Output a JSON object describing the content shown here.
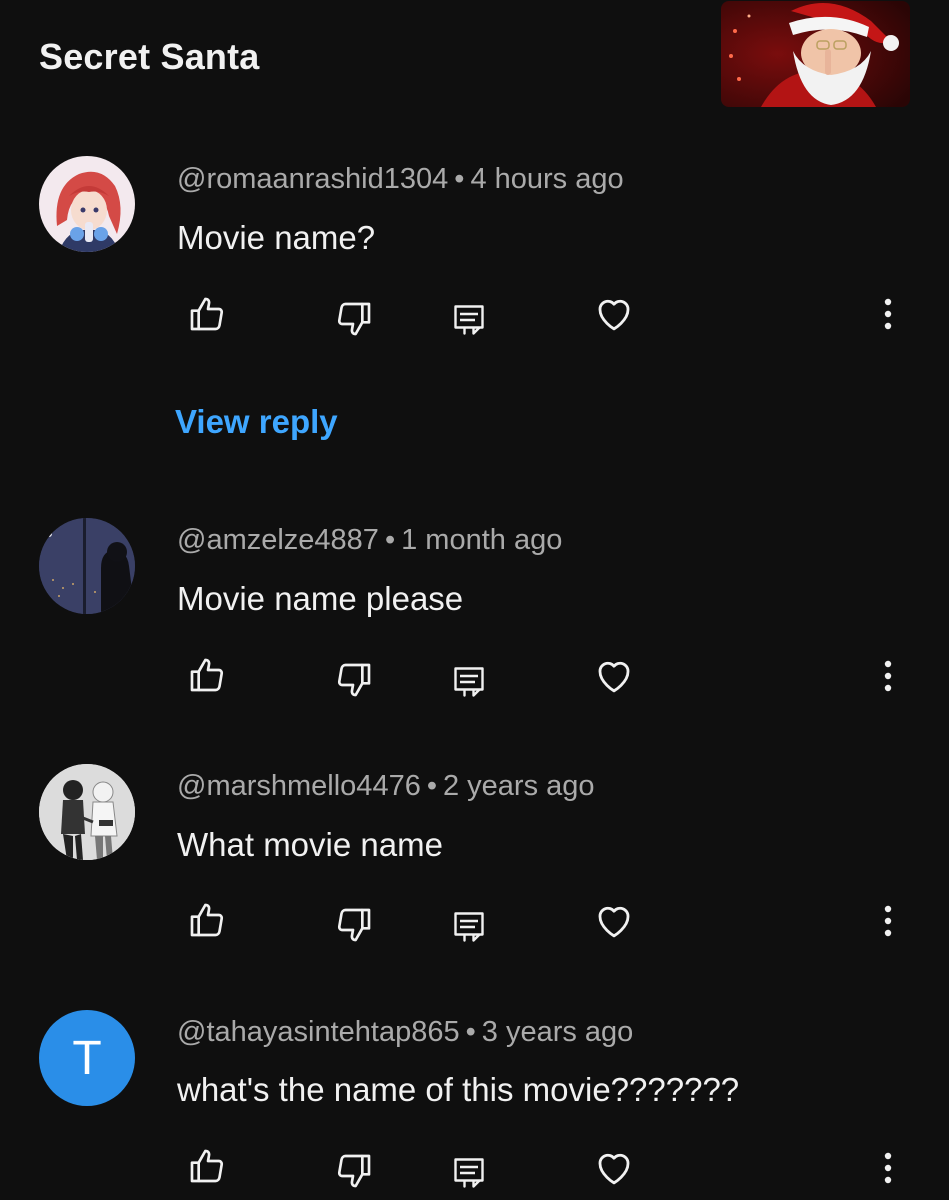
{
  "header": {
    "title": "Secret Santa"
  },
  "comments": [
    {
      "author": "@romaanrashid1304",
      "time": "4 hours ago",
      "text": "Movie name?",
      "avatar": "anime-girl-avatar",
      "view_reply": "View reply"
    },
    {
      "author": "@amzelze4887",
      "time": "1 month ago",
      "text": "Movie name please",
      "avatar": "night-window-avatar"
    },
    {
      "author": "@marshmello4476",
      "time": "2 years ago",
      "text": "What movie name",
      "avatar": "couple-manga-avatar"
    },
    {
      "author": "@tahayasintehtap865",
      "time": "3 years ago",
      "text": "what's the name of this movie???????",
      "avatar_letter": "T"
    }
  ],
  "separator": "•",
  "colors": {
    "background": "#0f0f0f",
    "text_primary": "#f1f1f1",
    "text_secondary": "#aaaaaa",
    "link": "#3ea6ff",
    "avatar_letter_bg": "#2a8ee8"
  },
  "icons": [
    "thumbs-up-icon",
    "thumbs-down-icon",
    "reply-icon",
    "heart-icon",
    "more-vertical-icon"
  ]
}
